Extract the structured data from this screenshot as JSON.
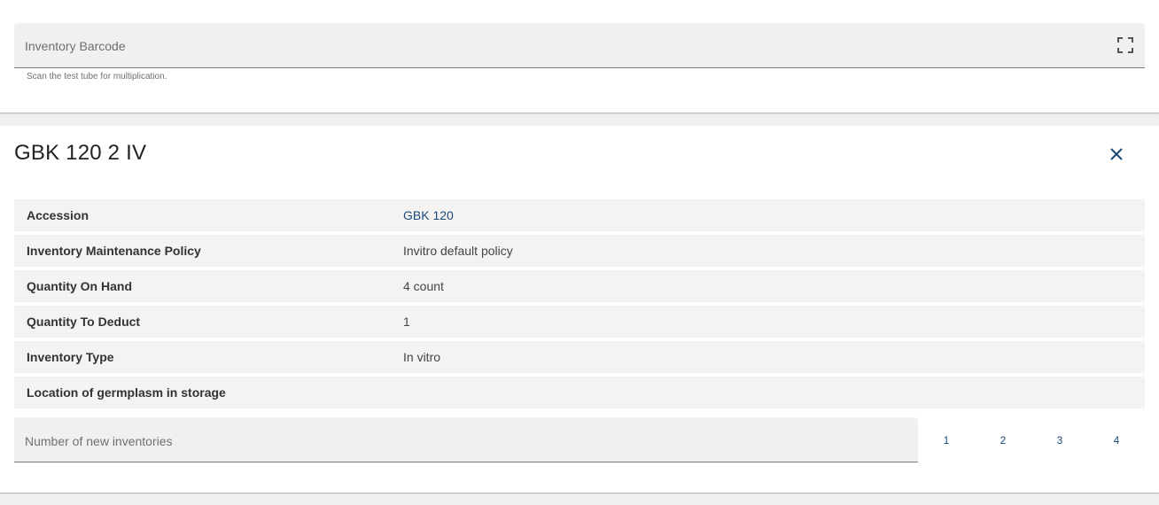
{
  "barcode": {
    "placeholder": "Inventory Barcode",
    "hint": "Scan the test tube for multiplication.",
    "icon": "fullscreen-scan-icon"
  },
  "detail": {
    "title": "GBK 120 2 IV",
    "close_icon": "close-icon",
    "rows": [
      {
        "label": "Accession",
        "value": "GBK 120"
      },
      {
        "label": "Inventory Maintenance Policy",
        "value": "Invitro default policy"
      },
      {
        "label": "Quantity On Hand",
        "value": "4 count"
      },
      {
        "label": "Quantity To Deduct",
        "value": "1"
      },
      {
        "label": "Inventory Type",
        "value": "In vitro"
      },
      {
        "label": "Location of germplasm in storage",
        "value": ""
      }
    ]
  },
  "new_inventories": {
    "placeholder": "Number of new inventories",
    "options": [
      "1",
      "2",
      "3",
      "4"
    ]
  },
  "colors": {
    "accent": "#1a4a7a",
    "field_bg": "#f0f0f0",
    "row_bg": "#f4f3f1"
  }
}
